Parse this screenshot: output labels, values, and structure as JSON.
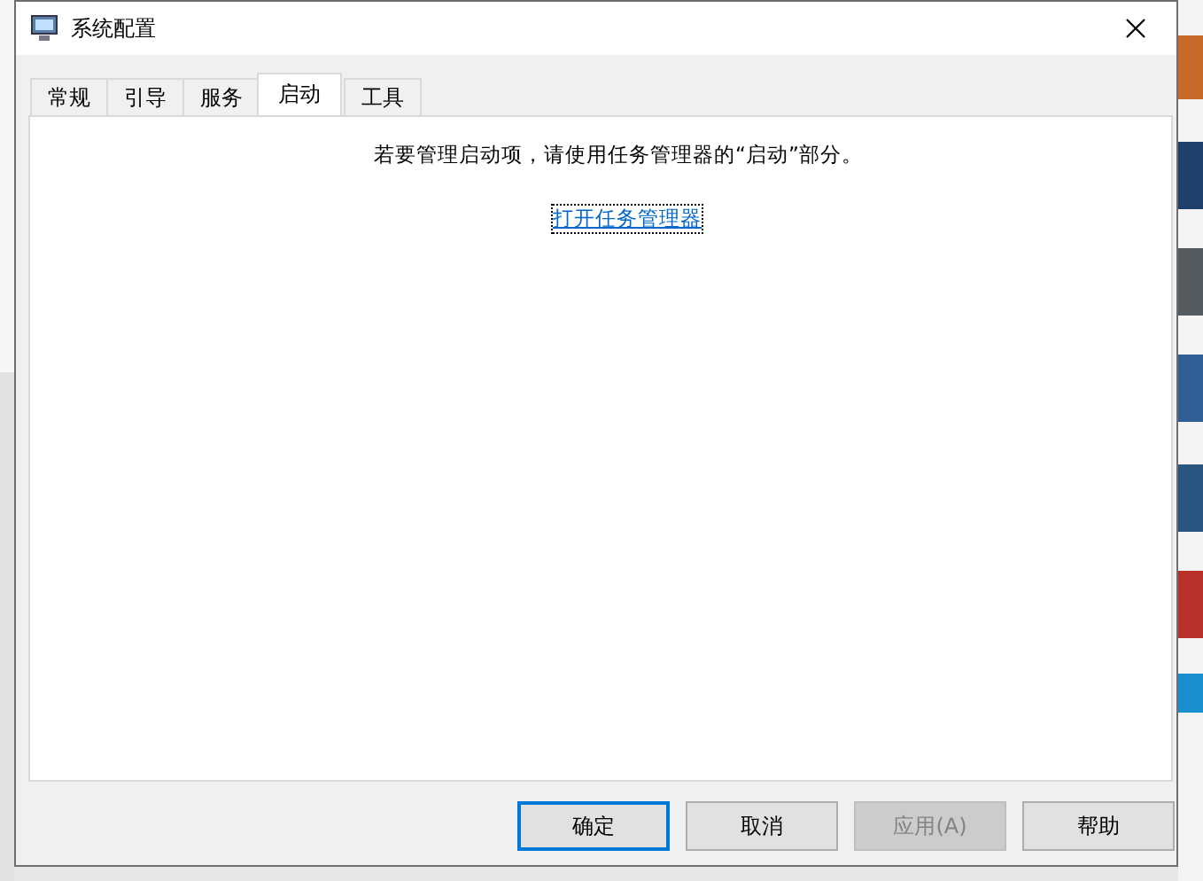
{
  "window": {
    "title": "系统配置"
  },
  "tabs": [
    {
      "label": "常规",
      "selected": false
    },
    {
      "label": "引导",
      "selected": false
    },
    {
      "label": "服务",
      "selected": false
    },
    {
      "label": "启动",
      "selected": true
    },
    {
      "label": "工具",
      "selected": false
    }
  ],
  "message": "若要管理启动项，请使用任务管理器的“启动”部分。",
  "link": "打开任务管理器",
  "buttons": [
    {
      "label": "确定",
      "default": true,
      "disabled": false
    },
    {
      "label": "取消",
      "default": false,
      "disabled": false
    },
    {
      "label": "应用(A)",
      "default": false,
      "disabled": true
    },
    {
      "label": "帮助",
      "default": false,
      "disabled": false
    }
  ]
}
